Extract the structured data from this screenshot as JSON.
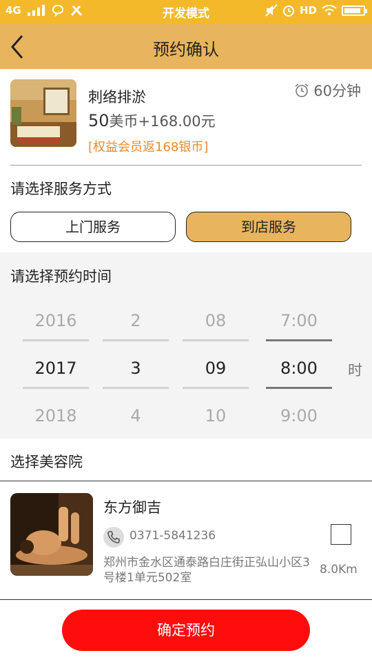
{
  "status_bar": {
    "network": "4G",
    "title": "开发模式",
    "hd": "HD",
    "battery_level": 0.9
  },
  "header": {
    "title": "预约确认"
  },
  "product": {
    "name": "刺络排淤",
    "price_coin": "50",
    "price_rest": "美币+168.00元",
    "rebate": "[权益会员返168银币]",
    "duration": "60分钟"
  },
  "service": {
    "label": "请选择服务方式",
    "options": [
      {
        "label": "上门服务",
        "selected": false
      },
      {
        "label": "到店服务",
        "selected": true
      }
    ]
  },
  "time_picker": {
    "label": "请选择预约时间",
    "year": [
      "2016",
      "2017",
      "2018"
    ],
    "month": [
      "2",
      "3",
      "4"
    ],
    "day": [
      "08",
      "09",
      "10"
    ],
    "time": [
      "7:00",
      "8:00",
      "9:00"
    ],
    "hour_unit": "时"
  },
  "salon": {
    "section_label": "选择美容院",
    "name": "东方御吉",
    "phone": "0371-5841236",
    "address": "郑州市金水区通泰路白庄街正弘山小区3号楼1单元502室",
    "distance": "8.0Km",
    "selected": false
  },
  "confirm": {
    "label": "确定预约"
  },
  "colors": {
    "status_bar": "#f4b92b",
    "header": "#e8b45e",
    "selected_option": "#e8b45e",
    "rebate_text": "#f08a2c",
    "confirm_button": "#ff0d0d"
  }
}
